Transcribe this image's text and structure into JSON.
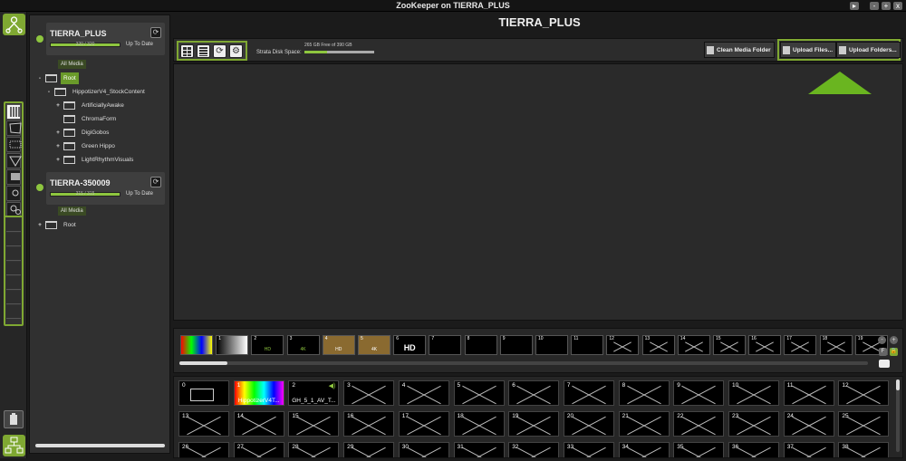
{
  "window": {
    "title": "ZooKeeper on TIERRA_PLUS"
  },
  "colors": {
    "accent": "#7fa832",
    "progress": "#8ec63f",
    "arrow": "#6ab520"
  },
  "servers": [
    {
      "name": "TIERRA_PLUS",
      "progress_text": "320 / 320",
      "progress": 1.0,
      "status": "Up To Date",
      "all_media": "All Media",
      "tree": [
        {
          "label": "Root",
          "expander": "-",
          "level": 0,
          "selected": true
        },
        {
          "label": "HippotizerV4_StockContent",
          "expander": "-",
          "level": 1,
          "selected": false
        },
        {
          "label": "ArtificiallyAwake",
          "expander": "+",
          "level": 2,
          "selected": false
        },
        {
          "label": "ChromaForm",
          "expander": "",
          "level": 2,
          "selected": false
        },
        {
          "label": "DigiGobos",
          "expander": "+",
          "level": 2,
          "selected": false
        },
        {
          "label": "Green Hippo",
          "expander": "+",
          "level": 2,
          "selected": false
        },
        {
          "label": "LightRhythmVisuals",
          "expander": "+",
          "level": 2,
          "selected": false
        }
      ]
    },
    {
      "name": "TIERRA-350009",
      "progress_text": "315 / 315",
      "progress": 1.0,
      "status": "Up To Date",
      "all_media": "All Media",
      "tree": [
        {
          "label": "Root",
          "expander": "+",
          "level": 0,
          "selected": false
        }
      ]
    }
  ],
  "main": {
    "title": "TIERRA_PLUS"
  },
  "toolbar": {
    "disk_label": "Strata Disk Space:",
    "disk_free": "265 GB Free of 390 GB",
    "disk_used_fraction": 0.32,
    "clean_label": "Clean Media Folder",
    "upload_files_label": "Upload Files...",
    "upload_folders_label": "Upload Folders...",
    "icons": [
      "grid-view-icon",
      "list-view-icon",
      "sync-icon",
      "settings-icon"
    ]
  },
  "strip": {
    "thumbs": [
      {
        "num": "",
        "text": "",
        "kind": "testcard"
      },
      {
        "num": "1",
        "text": "",
        "kind": "gradient"
      },
      {
        "num": "2",
        "text": "HD",
        "kind": "greenlogo"
      },
      {
        "num": "3",
        "text": "4K",
        "kind": "greenlogo"
      },
      {
        "num": "4",
        "text": "HD",
        "kind": "orangelogo"
      },
      {
        "num": "5",
        "text": "4K",
        "kind": "orangelogo"
      },
      {
        "num": "6",
        "text": "HD",
        "kind": "signature"
      },
      {
        "num": "7",
        "text": "",
        "kind": "dark"
      },
      {
        "num": "8",
        "text": "",
        "kind": "dark"
      },
      {
        "num": "9",
        "text": "",
        "kind": "blue"
      },
      {
        "num": "10",
        "text": "",
        "kind": "blue"
      },
      {
        "num": "11",
        "text": "",
        "kind": "blue"
      },
      {
        "num": "12",
        "text": "",
        "kind": "x"
      },
      {
        "num": "13",
        "text": "",
        "kind": "x"
      },
      {
        "num": "14",
        "text": "",
        "kind": "x"
      },
      {
        "num": "15",
        "text": "",
        "kind": "x"
      },
      {
        "num": "16",
        "text": "",
        "kind": "x"
      },
      {
        "num": "17",
        "text": "",
        "kind": "x"
      },
      {
        "num": "18",
        "text": "",
        "kind": "x"
      },
      {
        "num": "19",
        "text": "",
        "kind": "x"
      }
    ],
    "scroll_fraction": 0.07
  },
  "grid": {
    "cells": [
      {
        "num": "0",
        "text": "",
        "kind": "folder"
      },
      {
        "num": "1",
        "text": "HippotizerV4T...",
        "kind": "testcard"
      },
      {
        "num": "2",
        "text": "GH_5_1_AV_T...",
        "kind": "audio"
      },
      {
        "num": "3",
        "kind": "x"
      },
      {
        "num": "4",
        "kind": "x"
      },
      {
        "num": "5",
        "kind": "x"
      },
      {
        "num": "6",
        "kind": "x"
      },
      {
        "num": "7",
        "kind": "x"
      },
      {
        "num": "8",
        "kind": "x"
      },
      {
        "num": "9",
        "kind": "x"
      },
      {
        "num": "10",
        "kind": "x"
      },
      {
        "num": "11",
        "kind": "x"
      },
      {
        "num": "12",
        "kind": "x"
      },
      {
        "num": "13",
        "kind": "x"
      },
      {
        "num": "14",
        "kind": "x"
      },
      {
        "num": "15",
        "kind": "x"
      },
      {
        "num": "16",
        "kind": "x"
      },
      {
        "num": "17",
        "kind": "x"
      },
      {
        "num": "18",
        "kind": "x"
      },
      {
        "num": "19",
        "kind": "x"
      },
      {
        "num": "20",
        "kind": "x"
      },
      {
        "num": "21",
        "kind": "x"
      },
      {
        "num": "22",
        "kind": "x"
      },
      {
        "num": "23",
        "kind": "x"
      },
      {
        "num": "24",
        "kind": "x"
      },
      {
        "num": "25",
        "kind": "x"
      },
      {
        "num": "26",
        "kind": "x"
      },
      {
        "num": "27",
        "kind": "x"
      },
      {
        "num": "28",
        "kind": "x"
      },
      {
        "num": "29",
        "kind": "x"
      },
      {
        "num": "30",
        "kind": "x"
      },
      {
        "num": "31",
        "kind": "x"
      },
      {
        "num": "32",
        "kind": "x"
      },
      {
        "num": "33",
        "kind": "x"
      },
      {
        "num": "34",
        "kind": "x"
      },
      {
        "num": "35",
        "kind": "x"
      },
      {
        "num": "36",
        "kind": "x"
      },
      {
        "num": "37",
        "kind": "x"
      },
      {
        "num": "38",
        "kind": "x"
      }
    ]
  }
}
